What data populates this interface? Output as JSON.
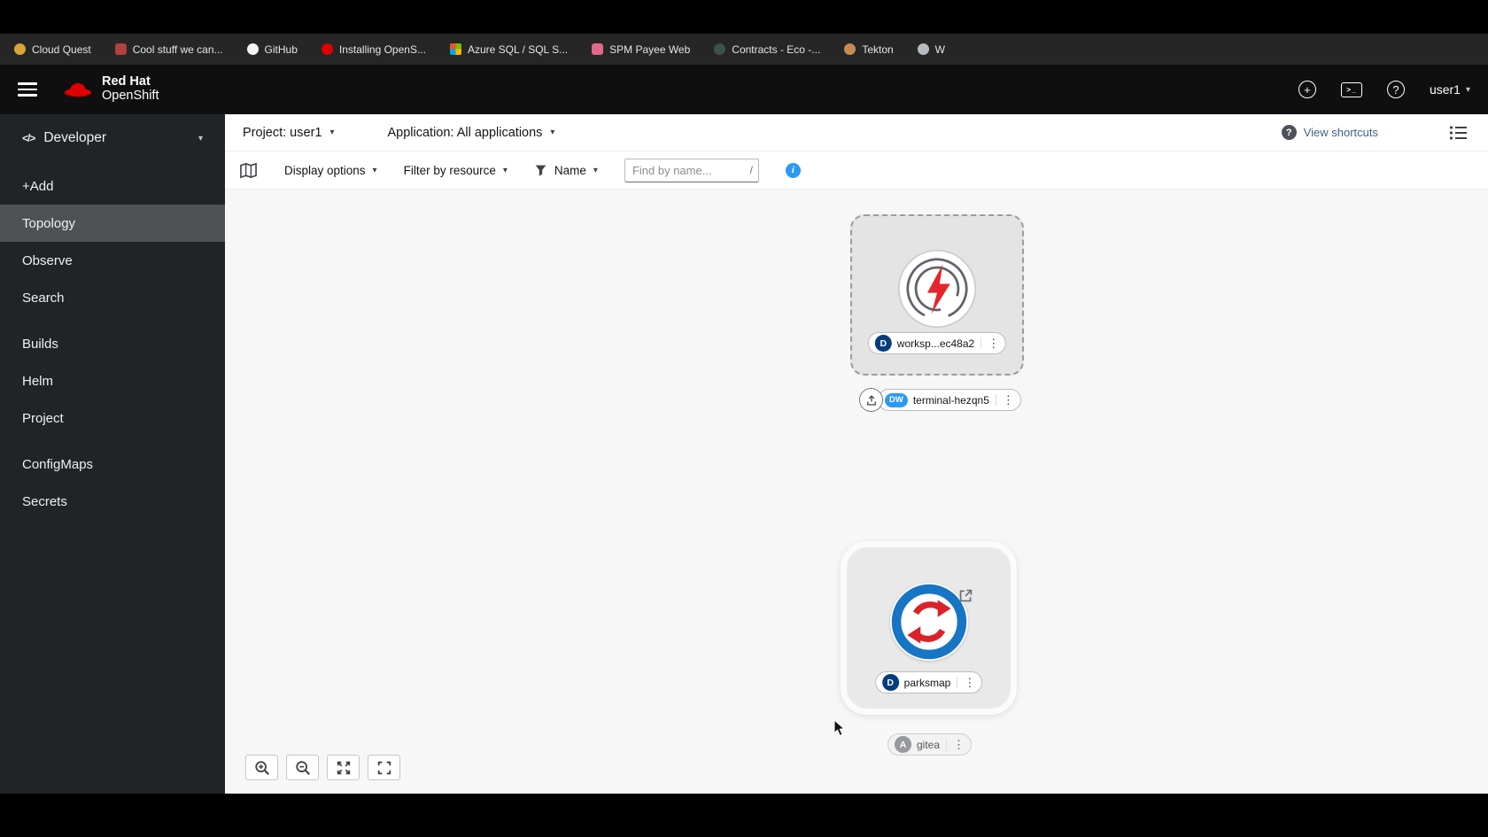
{
  "colors": {
    "deployment_badge": "#003e7e",
    "devworkspace_badge": "#2b9af3",
    "app_badge": "#8a8d90",
    "info_icon": "#2b9af3",
    "link_blue": "#3e6186",
    "redhat_red": "#e00000"
  },
  "bookmarks_bar": {
    "items": [
      {
        "label": "Cloud Quest",
        "color": "#d9a43a",
        "shape": "round"
      },
      {
        "label": "Cool stuff we can...",
        "color": "#b0413e",
        "shape": "square"
      },
      {
        "label": "GitHub",
        "color": "#f5f5f5",
        "shape": "round"
      },
      {
        "label": "Installing OpenS...",
        "color": "#e00000",
        "shape": "round"
      },
      {
        "label": "Azure SQL / SQL S...",
        "color": "#2e7fd1",
        "shape": "grid"
      },
      {
        "label": "SPM Payee Web",
        "color": "#e2688b",
        "shape": "square"
      },
      {
        "label": "Contracts - Eco -...",
        "color": "#3c5148",
        "shape": "round"
      },
      {
        "label": "Tekton",
        "color": "#c58b53",
        "shape": "round"
      },
      {
        "label": "W",
        "color": "#b8bcc0",
        "shape": "round"
      }
    ]
  },
  "masthead": {
    "brand_line1": "Red Hat",
    "brand_line2": "OpenShift",
    "user": "user1"
  },
  "sidebar": {
    "perspective": "Developer",
    "items": [
      {
        "label": "+Add"
      },
      {
        "label": "Topology"
      },
      {
        "label": "Observe"
      },
      {
        "label": "Search"
      },
      {
        "label": "Builds"
      },
      {
        "label": "Helm"
      },
      {
        "label": "Project"
      },
      {
        "label": "ConfigMaps"
      },
      {
        "label": "Secrets"
      }
    ]
  },
  "context_bar": {
    "project_label": "Project: user1",
    "application_label": "Application: All applications",
    "view_shortcuts_label": "View shortcuts"
  },
  "toolbar": {
    "display_options_label": "Display options",
    "filter_by_resource_label": "Filter by resource",
    "name_filter_label": "Name",
    "find_placeholder": "Find by name...",
    "shortcut_hint": "/"
  },
  "topology": {
    "workspace_node": {
      "badge": "D",
      "label": "worksp...ec48a2"
    },
    "terminal_node": {
      "badge": "DW",
      "label": "terminal-hezqn5"
    },
    "parksmap_node": {
      "badge": "D",
      "label": "parksmap"
    },
    "gitea_node": {
      "badge": "A",
      "label": "gitea"
    }
  }
}
